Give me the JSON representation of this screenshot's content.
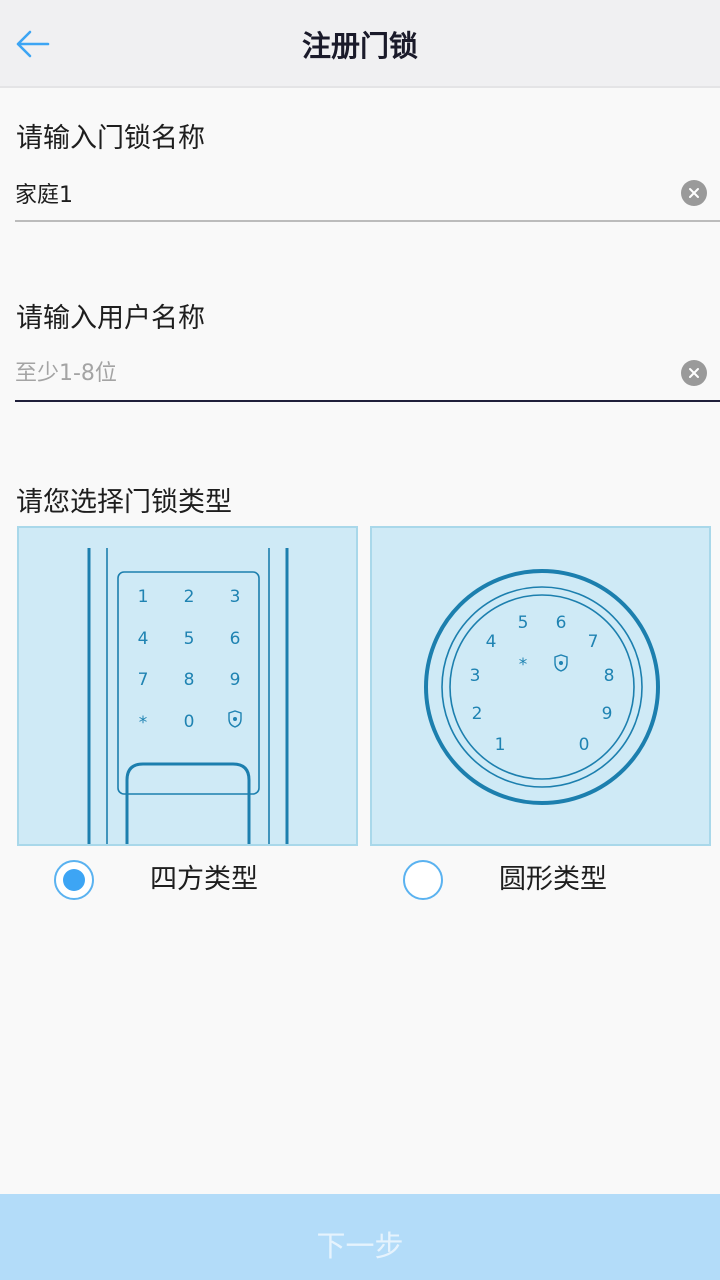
{
  "header": {
    "title": "注册门锁",
    "back_icon": "arrow-left-icon",
    "accent_color": "#3da5f4"
  },
  "lock_name": {
    "label": "请输入门锁名称",
    "value": "家庭1",
    "placeholder": ""
  },
  "user_name": {
    "label": "请输入用户名称",
    "value": "",
    "placeholder": "至少1-8位"
  },
  "lock_type": {
    "label": "请您选择门锁类型",
    "options": [
      {
        "label": "四方类型",
        "selected": true,
        "keys": [
          "1",
          "2",
          "3",
          "4",
          "5",
          "6",
          "7",
          "8",
          "9",
          "*",
          "0"
        ]
      },
      {
        "label": "圆形类型",
        "selected": false,
        "keys": [
          "5",
          "6",
          "4",
          "7",
          "3",
          "*",
          "8",
          "2",
          "9",
          "1",
          "0"
        ]
      }
    ]
  },
  "next_button": {
    "label": "下一步",
    "enabled": false
  }
}
